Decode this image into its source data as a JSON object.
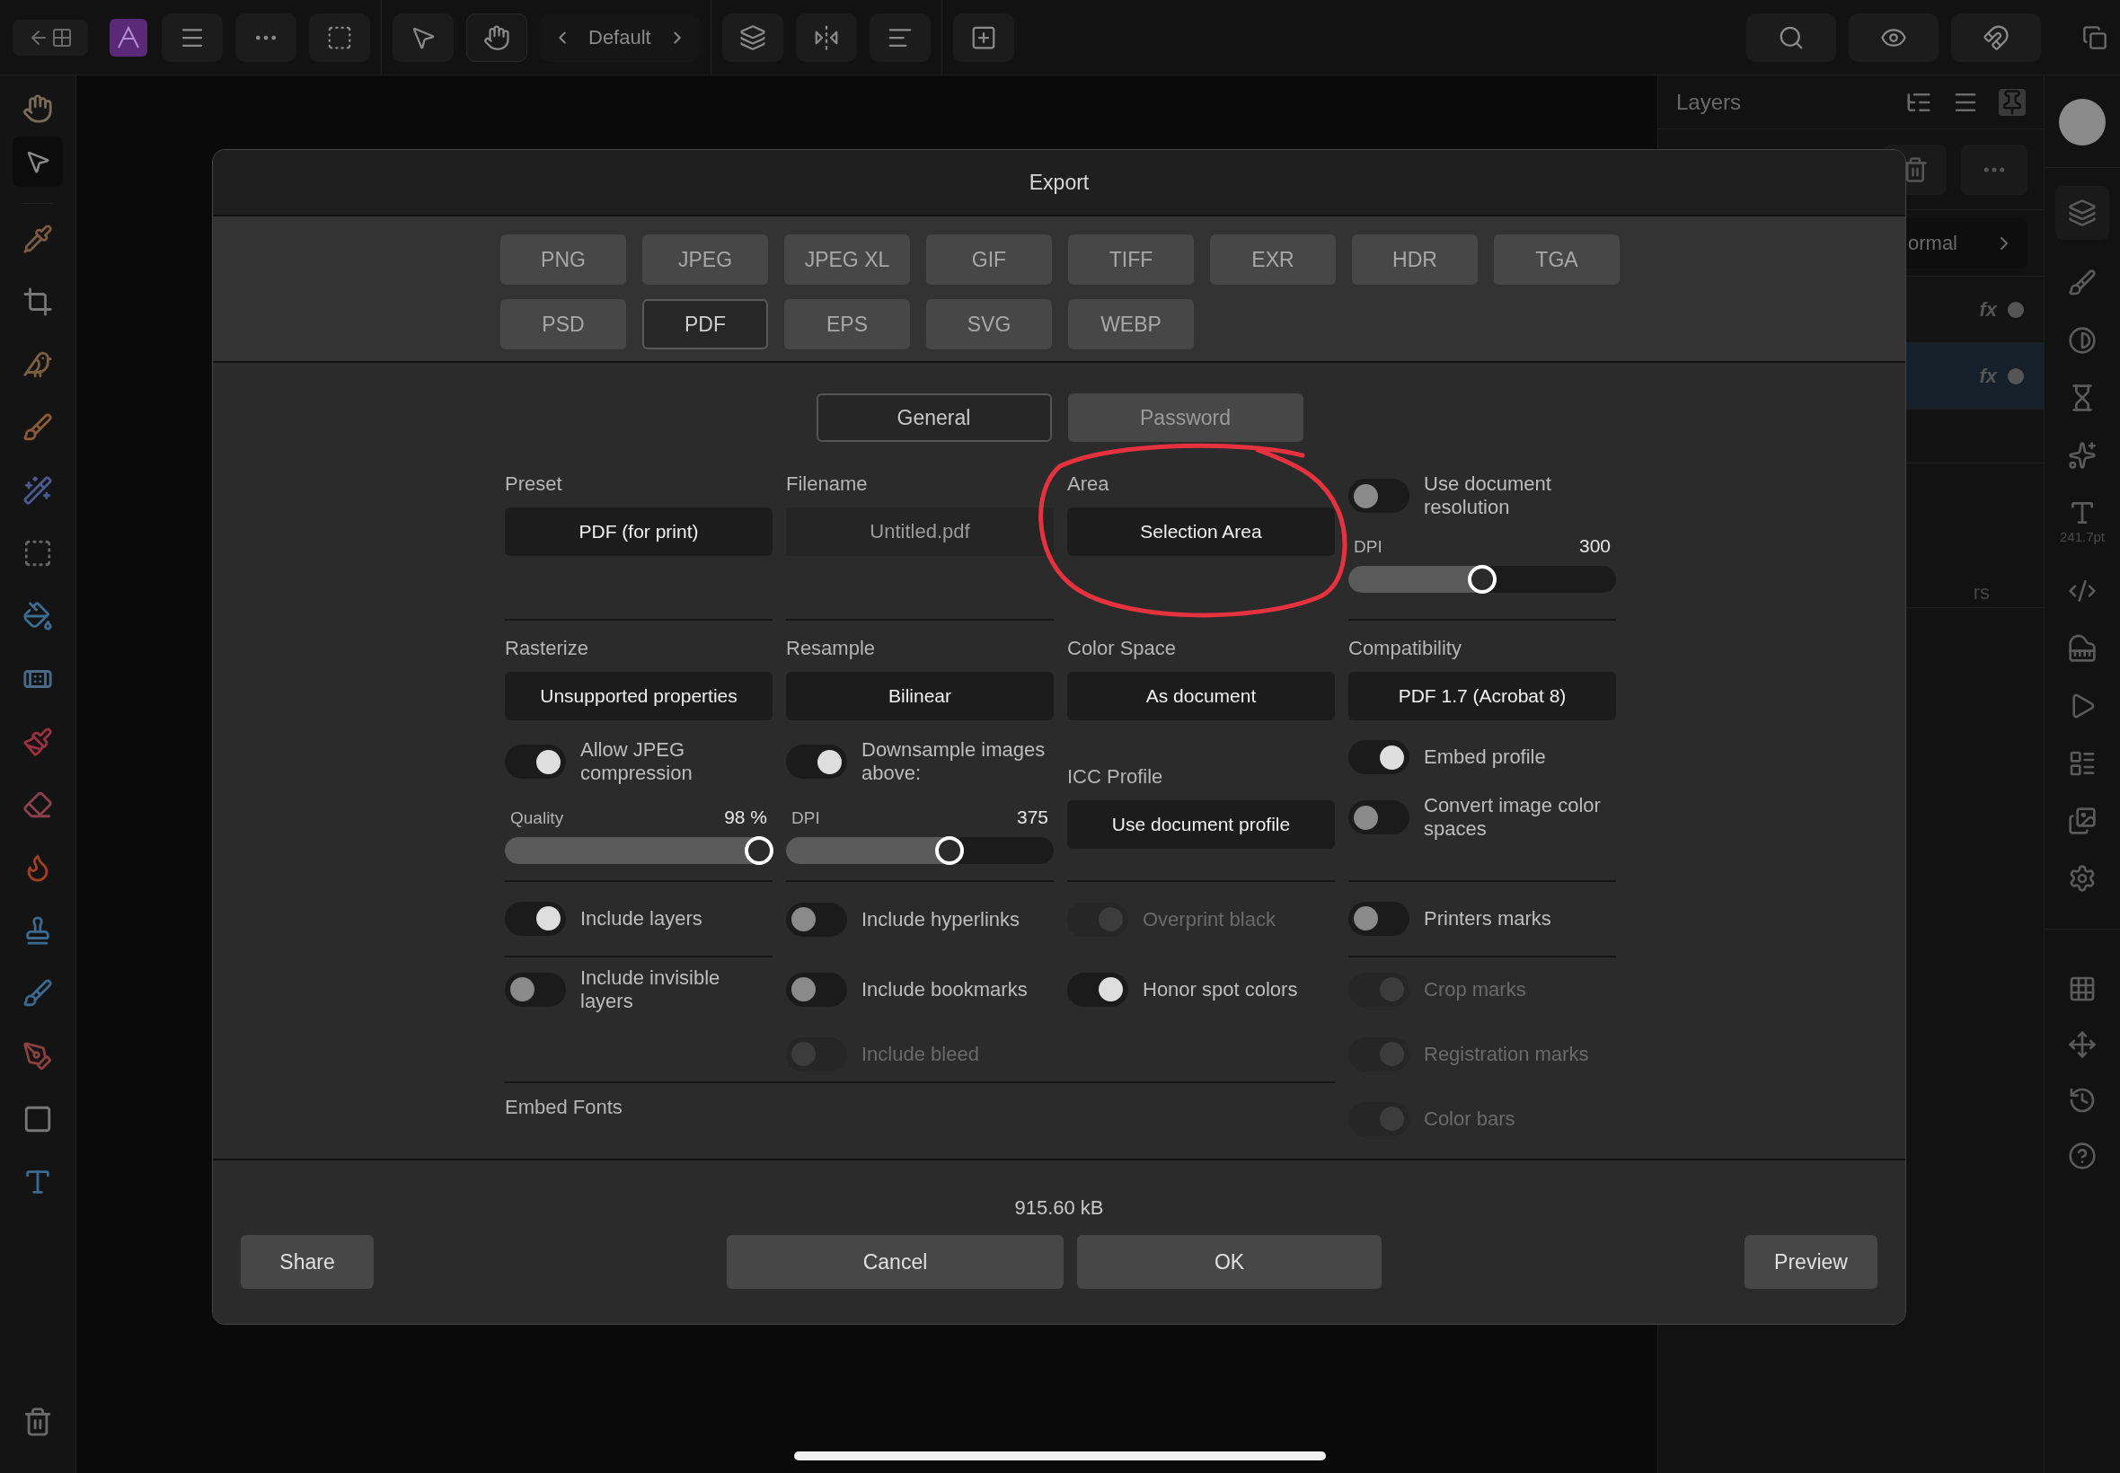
{
  "toolbar": {
    "preset": "Default"
  },
  "layers_panel": {
    "title": "Layers",
    "blend_mode": "ormal",
    "rows": [
      {
        "badge": "fx",
        "selected": false
      },
      {
        "badge": "fx",
        "selected": true
      }
    ],
    "hint": "rs"
  },
  "right_sidebar": {
    "font_size": "241.7pt"
  },
  "dialog": {
    "title": "Export",
    "formats": [
      {
        "label": "PNG",
        "selected": false
      },
      {
        "label": "JPEG",
        "selected": false
      },
      {
        "label": "JPEG XL",
        "selected": false
      },
      {
        "label": "GIF",
        "selected": false
      },
      {
        "label": "TIFF",
        "selected": false
      },
      {
        "label": "EXR",
        "selected": false
      },
      {
        "label": "HDR",
        "selected": false
      },
      {
        "label": "TGA",
        "selected": false
      },
      {
        "label": "PSD",
        "selected": false
      },
      {
        "label": "PDF",
        "selected": true
      },
      {
        "label": "EPS",
        "selected": false
      },
      {
        "label": "SVG",
        "selected": false
      },
      {
        "label": "WEBP",
        "selected": false
      }
    ],
    "tabs": [
      {
        "label": "General",
        "selected": true
      },
      {
        "label": "Password",
        "selected": false
      }
    ],
    "settings": {
      "preset": {
        "label": "Preset",
        "value": "PDF (for print)"
      },
      "filename": {
        "label": "Filename",
        "value": "Untitled.pdf"
      },
      "area": {
        "label": "Area",
        "value": "Selection Area"
      },
      "use_document_resolution": {
        "label": "Use document resolution",
        "on": false,
        "disabled": false
      },
      "resolution": {
        "label": "DPI",
        "reading": "300",
        "level": 0.5
      },
      "rasterize": {
        "label": "Rasterize",
        "value": "Unsupported properties"
      },
      "resample": {
        "label": "Resample",
        "value": "Bilinear"
      },
      "color_space": {
        "label": "Color Space",
        "value": "As document"
      },
      "compatibility": {
        "label": "Compatibility",
        "value": "PDF 1.7 (Acrobat 8)"
      },
      "jpeg_compression": {
        "label": "Allow JPEG compression",
        "on": true,
        "disabled": false
      },
      "quality": {
        "label": "Quality",
        "reading": "98 %",
        "level": 0.95
      },
      "downsample": {
        "label": "Downsample images above:",
        "on": true,
        "disabled": false
      },
      "downsample_dpi": {
        "label": "DPI",
        "reading": "375",
        "level": 0.61
      },
      "icc_profile": {
        "label": "ICC Profile",
        "value": "Use document profile"
      },
      "embed_profile": {
        "label": "Embed profile",
        "on": true,
        "disabled": false
      },
      "convert_color_spaces": {
        "label": "Convert image color spaces",
        "on": false,
        "disabled": false
      }
    },
    "option_columns": [
      {
        "toggles": [
          {
            "label": "Include layers",
            "on": true,
            "disabled": false
          },
          {
            "label": "Include invisible layers",
            "on": false,
            "disabled": false
          }
        ]
      },
      {
        "toggles": [
          {
            "label": "Include hyperlinks",
            "on": false,
            "disabled": false
          },
          {
            "label": "Include bookmarks",
            "on": false,
            "disabled": false
          },
          {
            "label": "Include bleed",
            "on": false,
            "disabled": true
          }
        ]
      },
      {
        "toggles": [
          {
            "label": "Overprint black",
            "on": true,
            "disabled": true
          },
          {
            "label": "Honor spot colors",
            "on": true,
            "disabled": false
          }
        ]
      },
      {
        "toggles": [
          {
            "label": "Printers marks",
            "on": false,
            "disabled": false
          },
          {
            "label": "Crop marks",
            "on": true,
            "disabled": true
          },
          {
            "label": "Registration marks",
            "on": true,
            "disabled": true
          },
          {
            "label": "Color bars",
            "on": true,
            "disabled": true
          }
        ]
      }
    ],
    "embed_fonts_label": "Embed Fonts",
    "file_size": "915.60 kB",
    "buttons": [
      {
        "label": "Share",
        "kind": "side"
      },
      {
        "label": "Cancel",
        "kind": "cancel"
      },
      {
        "label": "OK",
        "kind": "ok"
      },
      {
        "label": "Preview",
        "kind": "side"
      }
    ]
  }
}
